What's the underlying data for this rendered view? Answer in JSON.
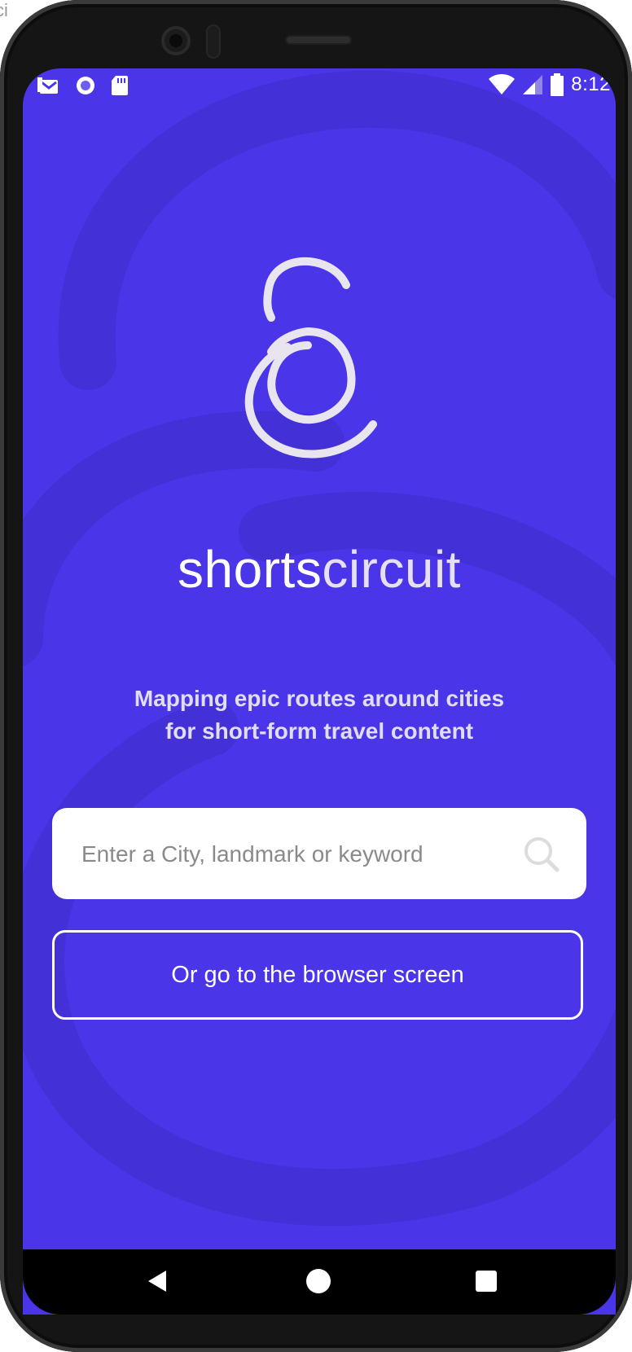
{
  "bezel": {
    "edge_text": "ci"
  },
  "status_bar": {
    "time": "8:12",
    "left_icons": [
      "mail-icon",
      "record-icon",
      "sd-card-icon"
    ],
    "right_icons": [
      "wifi-icon",
      "signal-icon",
      "battery-icon"
    ]
  },
  "brand": {
    "part1": "shorts",
    "part2": "circuit"
  },
  "tagline": {
    "line1": "Mapping epic routes around cities",
    "line2": "for short-form travel content"
  },
  "search": {
    "placeholder": "Enter a City, landmark or keyword",
    "value": ""
  },
  "browser_button": {
    "label": "Or go to the browser screen"
  },
  "colors": {
    "background": "#4a35e8",
    "swirl": "#4330d6",
    "logo_stroke": "#e8e5ef",
    "button_border": "#ffffff",
    "nav_bar": "#000000"
  }
}
